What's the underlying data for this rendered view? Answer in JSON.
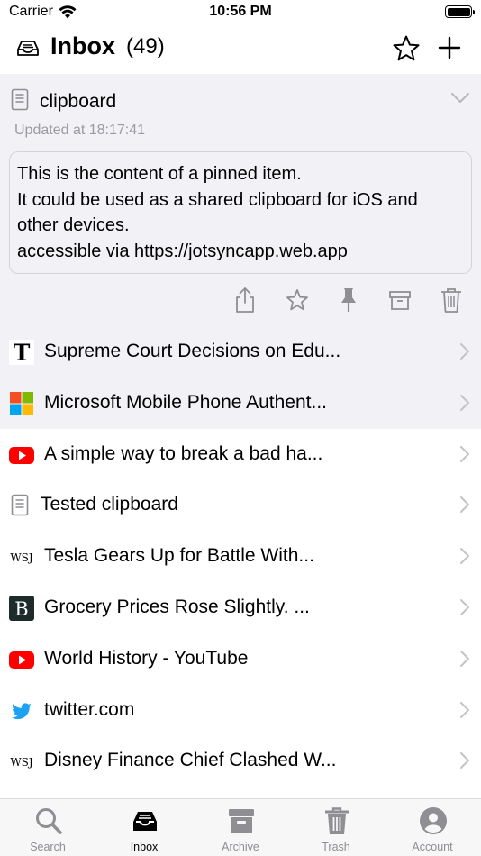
{
  "status_bar": {
    "carrier": "Carrier",
    "time": "10:56 PM"
  },
  "nav": {
    "title": "Inbox",
    "count": "(49)"
  },
  "pinned": {
    "title": "clipboard",
    "updated": "Updated at 18:17:41",
    "lines": [
      "This is the content of a pinned item.",
      "It could be used as a shared clipboard for iOS and",
      "other devices.",
      "accessible via https://jotsyncapp.web.app"
    ]
  },
  "items": [
    {
      "icon": "nyt-logo-icon",
      "label": "Supreme Court Decisions on Edu..."
    },
    {
      "icon": "microsoft-logo-icon",
      "label": "Microsoft Mobile Phone Authent..."
    },
    {
      "icon": "youtube-logo-icon",
      "label": "A simple way to break a bad ha..."
    },
    {
      "icon": "document-icon",
      "label": "Tested clipboard"
    },
    {
      "icon": "wsj-logo-icon",
      "label": "Tesla Gears Up for Battle With..."
    },
    {
      "icon": "bloomberg-logo-icon",
      "label": "Grocery Prices Rose Slightly. ..."
    },
    {
      "icon": "youtube-logo-icon",
      "label": "World History - YouTube"
    },
    {
      "icon": "twitter-logo-icon",
      "label": "twitter.com"
    },
    {
      "icon": "wsj-logo-icon",
      "label": "Disney Finance Chief Clashed W..."
    }
  ],
  "logo_text": {
    "wsj": "WSJ",
    "bloomberg": "B"
  },
  "tabs": [
    {
      "label": "Search",
      "icon": "search-icon"
    },
    {
      "label": "Inbox",
      "icon": "inbox-icon"
    },
    {
      "label": "Archive",
      "icon": "archive-icon"
    },
    {
      "label": "Trash",
      "icon": "trash-icon"
    },
    {
      "label": "Account",
      "icon": "account-icon"
    }
  ],
  "colors": {
    "shaded_bg": "#f2f1f6",
    "icon_gray": "#8e8e93",
    "youtube_red": "#ff0000",
    "twitter_blue": "#1da1f2"
  }
}
